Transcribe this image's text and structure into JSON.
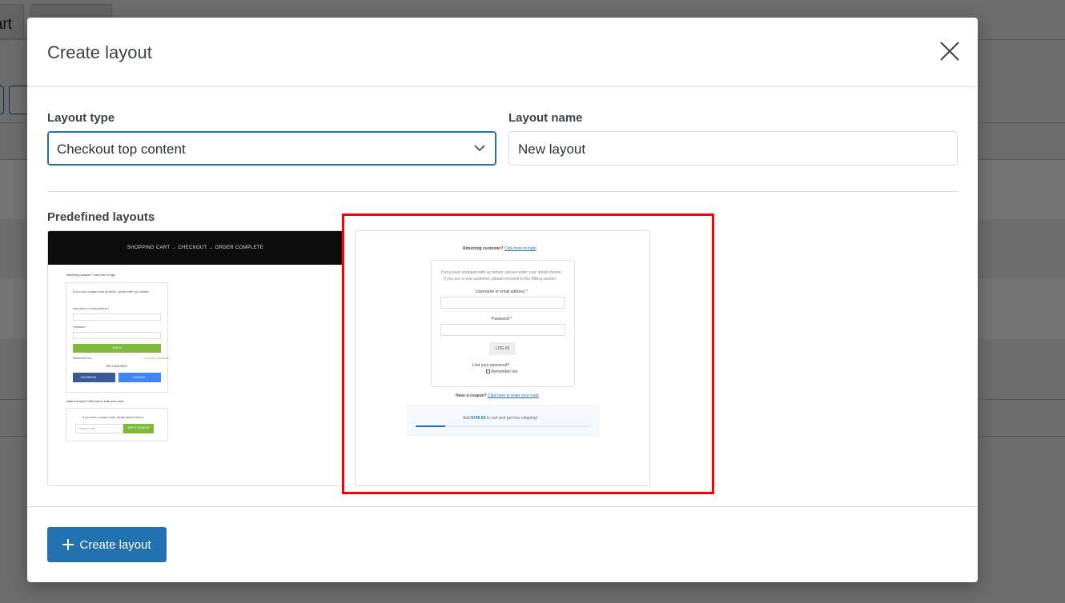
{
  "background": {
    "tab_partial_label": "art"
  },
  "modal": {
    "title": "Create layout",
    "layout_type": {
      "label": "Layout type",
      "selected": "Checkout top content"
    },
    "layout_name": {
      "label": "Layout name",
      "value": "New layout"
    },
    "predefined_label": "Predefined layouts",
    "create_button_label": "Create layout"
  },
  "preview1": {
    "nav": "SHOPPING CART  →  CHECKOUT  →  ORDER COMPLETE",
    "returning": "Returning customer? Click here to login",
    "intro": "If you have shopped with us before, please enter your details",
    "username": "Username or email address *",
    "password": "Password *",
    "login": "LOG IN",
    "remember": "Remember me",
    "lost": "Lost your password?",
    "or_login": "OR LOGIN WITH",
    "facebook": "FACEBOOK",
    "google": "GOOGLE",
    "coupon_q": "Have a coupon? Click here to enter your code",
    "coupon_text": "If you have a coupon code, please apply it below.",
    "coupon_placeholder": "Coupon code",
    "apply": "APPLY COUPON"
  },
  "preview2": {
    "returning": "Returning customer?",
    "returning_link": "Click here to login",
    "intro1": "If you have shopped with us before, please enter your details below.",
    "intro2": "If you are a new customer, please proceed to the Billing section.",
    "username": "Username or email address *",
    "password": "Password *",
    "login": "LOG IN",
    "lost": "Lost your password?",
    "remember": "Remember me",
    "coupon_q": "Have a coupon?",
    "coupon_link": "Click here to enter your code",
    "shipping_pre": "Add ",
    "shipping_amount": "$745.00",
    "shipping_post": " to cart and get free shipping!"
  },
  "colors": {
    "primary": "#2271b1",
    "highlight": "#ff0000",
    "preview_green": "#81b93f"
  }
}
